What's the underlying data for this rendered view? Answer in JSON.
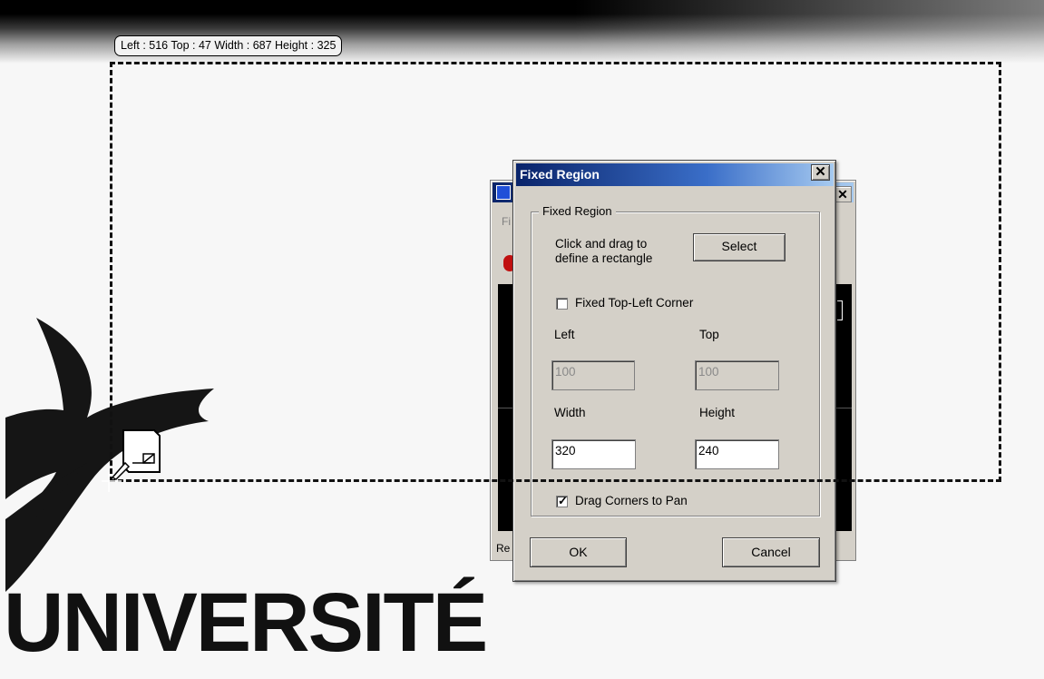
{
  "region_readout": "Left : 516  Top : 47  Width : 687  Height : 325",
  "logo": {
    "text": "UNIVERSITÉ"
  },
  "background_window": {
    "menu_fragment": "Fi",
    "status_fragment": "Re",
    "close_glyph": "✕"
  },
  "dialog": {
    "title": "Fixed Region",
    "close_glyph": "✕",
    "group_label": "Fixed Region",
    "instruction": "Click and drag to define a rectangle",
    "select_label": "Select",
    "fixed_corner": {
      "label": "Fixed Top-Left Corner",
      "checked": false
    },
    "left": {
      "label": "Left",
      "value": "100",
      "enabled": false
    },
    "top": {
      "label": "Top",
      "value": "100",
      "enabled": false
    },
    "width": {
      "label": "Width",
      "value": "320",
      "enabled": true
    },
    "height": {
      "label": "Height",
      "value": "240",
      "enabled": true
    },
    "drag_corners": {
      "label": "Drag Corners to Pan",
      "checked": true
    },
    "ok_label": "OK",
    "cancel_label": "Cancel"
  },
  "colors": {
    "titlebar_start": "#0a246a",
    "titlebar_end": "#a6caf0",
    "dialog_face": "#d4d0c8",
    "desktop": "#f7f7f7"
  }
}
